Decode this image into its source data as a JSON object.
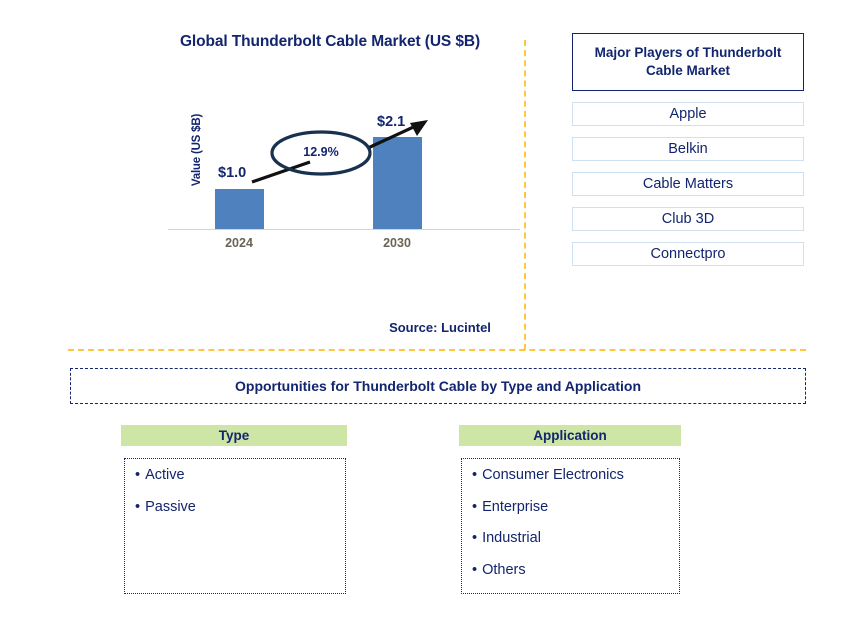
{
  "chart": {
    "title": "Global Thunderbolt Cable Market (US $B)",
    "ylabel": "Value (US $B)",
    "cagr": "12.9%",
    "source": "Source: Lucintel"
  },
  "chart_data": {
    "type": "bar",
    "title": "Global Thunderbolt Cable Market (US $B)",
    "categories": [
      "2024",
      "2030"
    ],
    "values": [
      1.0,
      2.1
    ],
    "data_labels": [
      "$1.0",
      "$2.1"
    ],
    "xlabel": "",
    "ylabel": "Value (US $B)",
    "ylim": [
      0,
      2.4
    ],
    "grid": false,
    "legend": "none",
    "annotations": [
      {
        "text": "12.9%",
        "type": "cagr-ellipse-arrow",
        "from": "2024",
        "to": "2030"
      }
    ],
    "series_color": "#4e81bd",
    "source": "Source: Lucintel"
  },
  "players": {
    "header": "Major Players of Thunderbolt Cable Market",
    "items": [
      "Apple",
      "Belkin",
      "Cable Matters",
      "Club 3D",
      "Connectpro"
    ]
  },
  "opportunities": {
    "title": "Opportunities for Thunderbolt Cable by Type and Application",
    "type": {
      "header": "Type",
      "items": [
        "Active",
        "Passive"
      ]
    },
    "application": {
      "header": "Application",
      "items": [
        "Consumer Electronics",
        "Enterprise",
        "Industrial",
        "Others"
      ]
    },
    "bullet": "•"
  },
  "colors": {
    "navy": "#12256e",
    "bar_blue": "#4e81bd",
    "divider_gold": "#ffc740",
    "header_green": "#cde5a5",
    "tick_gray": "#6b6355"
  }
}
